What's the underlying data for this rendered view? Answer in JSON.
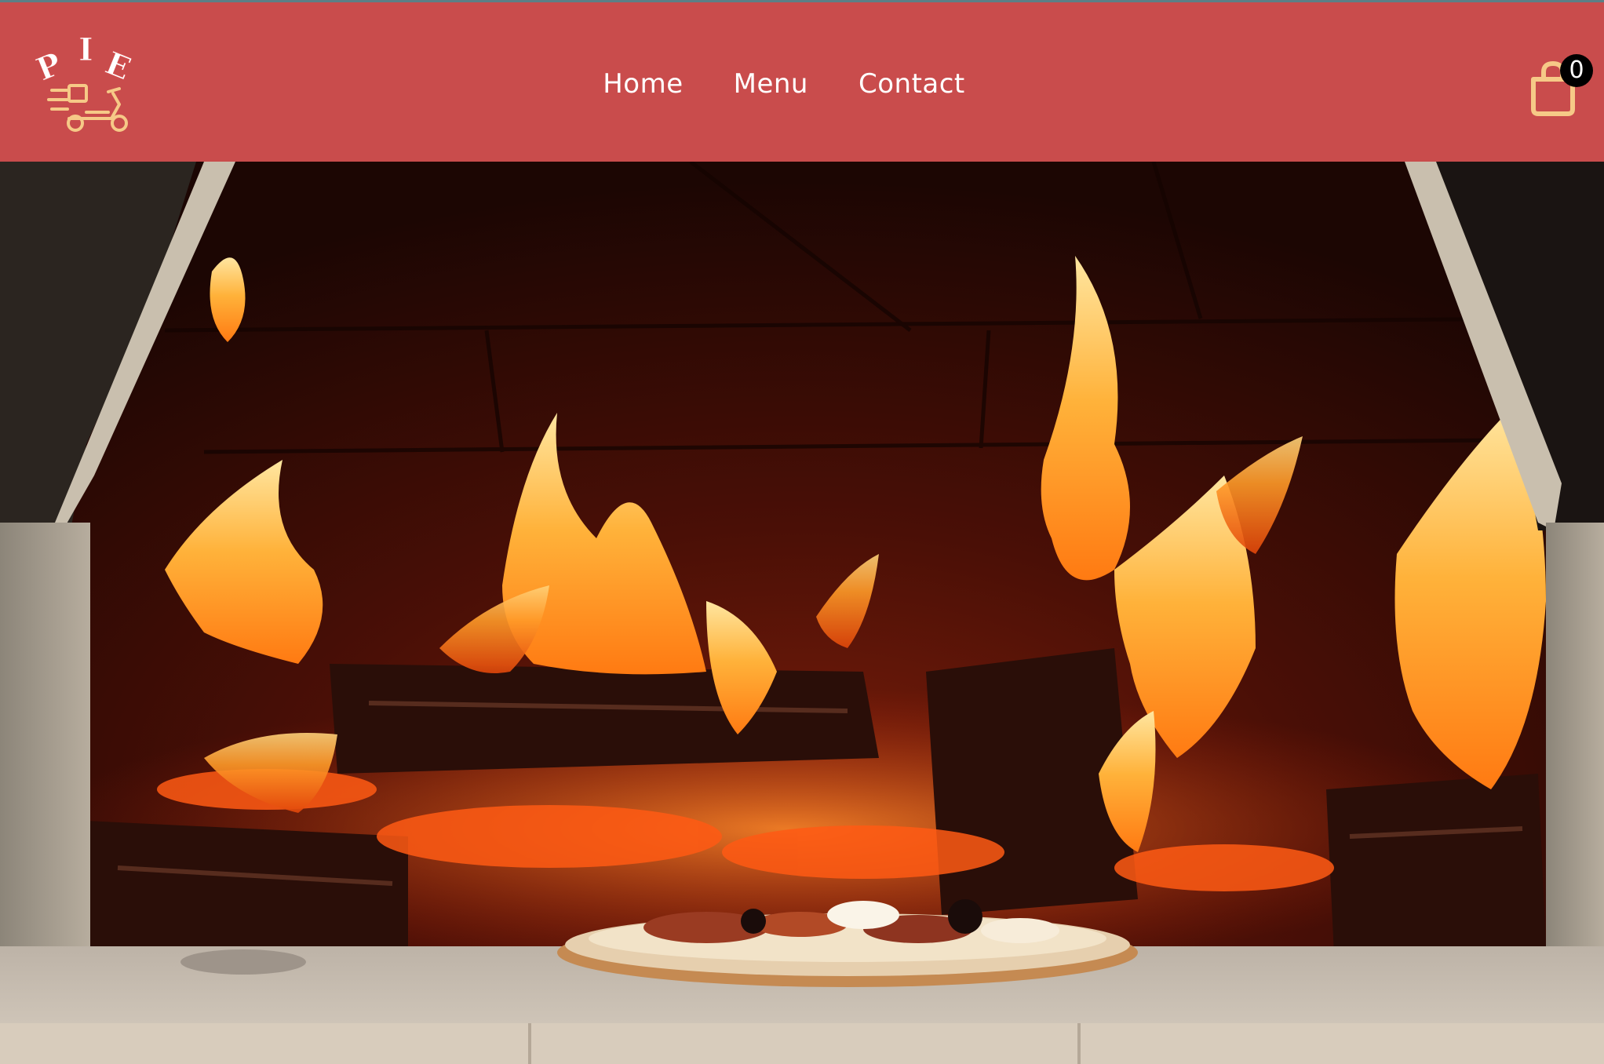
{
  "header": {
    "brand": "PIE",
    "background": "#c94c4c",
    "accent": "#f6c987",
    "nav": [
      {
        "label": "Home"
      },
      {
        "label": "Menu"
      },
      {
        "label": "Contact"
      }
    ],
    "cart": {
      "icon": "shopping-bag-icon",
      "count": "0"
    }
  },
  "hero": {
    "image": "wood-fired-oven-flames-with-pizza"
  }
}
